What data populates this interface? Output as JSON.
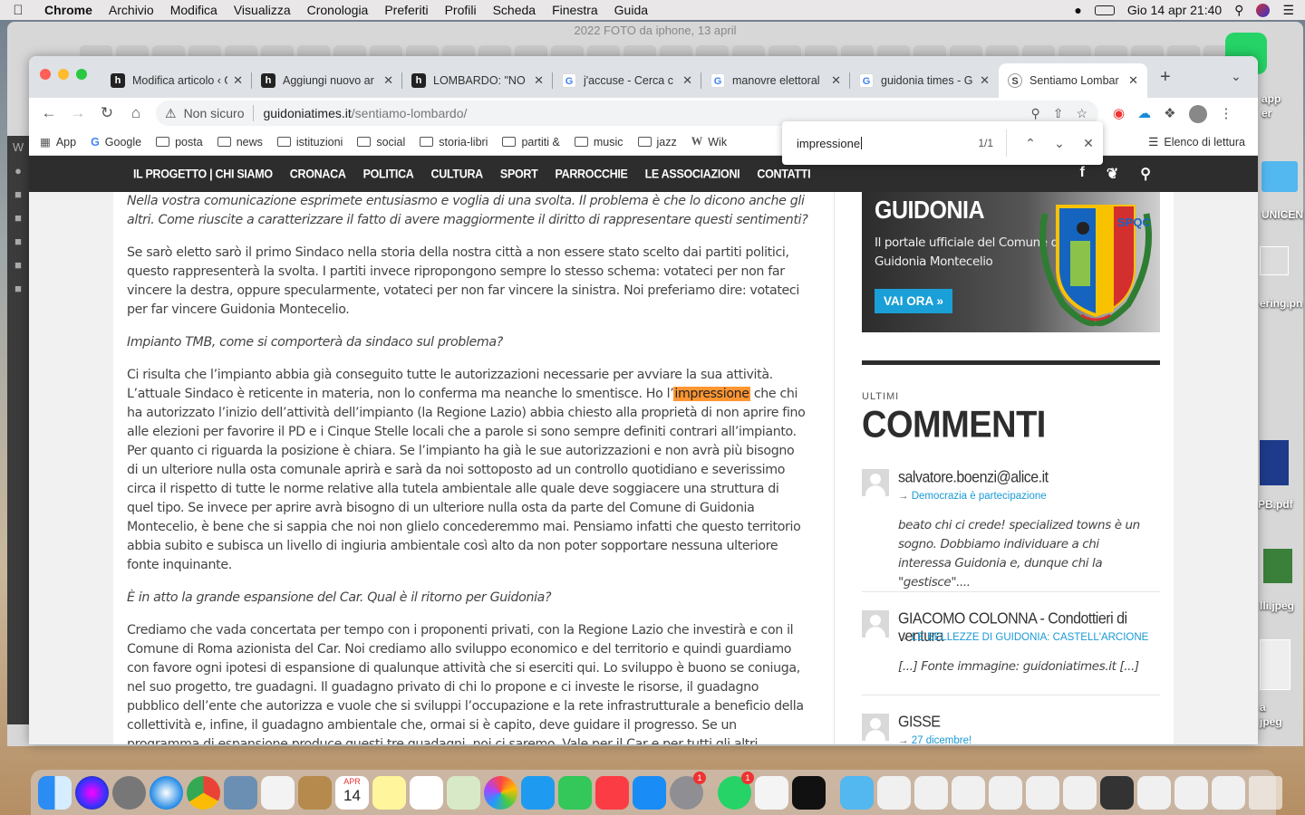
{
  "menubar": {
    "app": "Chrome",
    "items": [
      "Archivio",
      "Modifica",
      "Visualizza",
      "Cronologia",
      "Preferiti",
      "Profili",
      "Scheda",
      "Finestra",
      "Guida"
    ],
    "clock": "Gio 14 apr  21:40"
  },
  "bg_window": {
    "title": "2022 FOTO da iphone, 13 april"
  },
  "desktop_labels": [
    "app",
    "er",
    "UNICEN",
    "ering.pn",
    "PB.pdf",
    "lli.jpeg",
    "a",
    "jpeg"
  ],
  "tabs": [
    {
      "label": "Modifica articolo ‹ G",
      "icon": "h"
    },
    {
      "label": "Aggiungi nuovo ar",
      "icon": "h"
    },
    {
      "label": "LOMBARDO: \"NO",
      "icon": "h"
    },
    {
      "label": "j'accuse - Cerca c",
      "icon": "G"
    },
    {
      "label": "manovre elettoral",
      "icon": "G"
    },
    {
      "label": "guidonia times - G",
      "icon": "G"
    },
    {
      "label": "Sentiamo Lombar",
      "icon": "S"
    }
  ],
  "omnibox": {
    "security": "Non sicuro",
    "host": "guidoniatimes.it",
    "path": "/sentiamo-lombardo/"
  },
  "bookmarks": [
    "App",
    "Google",
    "posta",
    "news",
    "istituzioni",
    "social",
    "storia-libri",
    "partiti &",
    "music",
    "jazz",
    "Wik"
  ],
  "reading_list": "Elenco di lettura",
  "findbar": {
    "query": "impressione",
    "count": "1/1"
  },
  "site_nav": [
    "IL PROGETTO | CHI SIAMO",
    "CRONACA",
    "POLITICA",
    "CULTURA",
    "SPORT",
    "PARROCCHIE",
    "LE ASSOCIAZIONI",
    "CONTATTI"
  ],
  "article": {
    "q1": "Nella vostra comunicazione esprimete entusiasmo e voglia di una svolta. Il problema è che lo dicono anche gli altri. Come riuscite a caratterizzare il fatto di avere maggiormente il diritto di rappresentare questi sentimenti?",
    "a1": "Se sarò eletto sarò il primo Sindaco nella storia della nostra città a non essere stato scelto dai partiti politici, questo rappresenterà la svolta. I partiti invece ripropongono sempre lo stesso schema: votateci per non far vincere la destra, oppure specularmente, votateci per non far vincere la sinistra. Noi preferiamo dire: votateci per far vincere Guidonia Montecelio.",
    "q2": "Impianto TMB, come si comporterà da sindaco sul problema?",
    "a2_before": "Ci risulta che l’impianto abbia già conseguito tutte le autorizzazioni necessarie per avviare la sua attività. L’attuale Sindaco è reticente in materia, non lo conferma ma neanche lo smentisce. Ho l’",
    "a2_highlight": "impressione",
    "a2_after": " che chi ha autorizzato l’inizio dell’attività dell’impianto (la Regione Lazio) abbia chiesto alla proprietà di non aprire fino alle elezioni per favorire il PD e i Cinque Stelle locali che a parole si sono sempre definiti contrari all’impianto. Per quanto ci riguarda la posizione è chiara. Se l’impianto ha già le sue autorizzazioni e non avrà più bisogno di un ulteriore nulla osta comunale aprirà e sarà da noi sottoposto ad un controllo quotidiano e severissimo circa il rispetto di tutte le norme relative alla tutela ambientale alle quale deve soggiacere una struttura di quel tipo. Se invece per aprire avrà bisogno di un ulteriore nulla osta da parte del Comune di Guidonia Montecelio, è bene che si sappia che noi non glielo concederemmo mai. Pensiamo infatti che questo territorio abbia subito e subisca un livello di ingiuria ambientale così alto da non poter sopportare nessuna ulteriore fonte inquinante.",
    "q3": "È in atto la grande espansione del Car. Qual è il ritorno per Guidonia?",
    "a3": "Crediamo che vada concertata per tempo con i proponenti privati, con la Regione Lazio che investirà e con il Comune di Roma azionista del Car. Noi crediamo allo sviluppo economico e del territorio e quindi guardiamo con favore ogni ipotesi di espansione di qualunque attività che si eserciti qui. Lo sviluppo è buono se coniuga, nel suo progetto, tre guadagni. Il guadagno privato di chi lo propone e ci investe le risorse, il guadagno pubblico dell’ente che autorizza e vuole che si sviluppi l’occupazione e la rete infrastrutturale a beneficio della collettività e, infine, il guadagno ambientale che, ormai si è capito, deve guidare il progresso. Se un programma di espansione produce questi tre guadagni, noi ci saremo. Vale per il Car e per tutti gli altri. Sicuramente se ci sarà questo ampliamento il Comune di Guidonia Montecelio farà valere le sue ragioni con le altre Istituzioni, senza subire passivamente le"
  },
  "banner": {
    "title": "GUIDONIA",
    "subtitle": "Il portale ufficiale del Comune di Guidonia Montecelio",
    "button": "VAI ORA »",
    "crest_text": "SPQC"
  },
  "widget": {
    "kicker": "ULTIMI",
    "title": "COMMENTI"
  },
  "comments": [
    {
      "author": "salvatore.boenzi@alice.it",
      "arrow": "→",
      "post": "Democrazia è partecipazione",
      "excerpt": "beato chi ci crede! specialized towns è un sogno. Dobbiamo individuare a chi interessa Guidonia e, dunque chi la \"gestisce\"...."
    },
    {
      "author": "GIACOMO COLONNA - Condottieri di ventura",
      "arrow": "→",
      "post": "LE BELLEZZE DI GUIDONIA: CASTELL'ARCIONE",
      "excerpt": "[...] Fonte immagine: guidoniatimes.it [...]"
    },
    {
      "author": "GISSE",
      "arrow": "→",
      "post": "27 dicembre!",
      "excerpt": ""
    }
  ],
  "dock": {
    "calendar_month": "APR",
    "calendar_day": "14",
    "badge": "1"
  },
  "colors": {
    "find_highlight": "#ff9632",
    "nav_bg": "#2d2d2d",
    "link_blue": "#1a9ad6",
    "button_blue": "#1aa0d6"
  }
}
